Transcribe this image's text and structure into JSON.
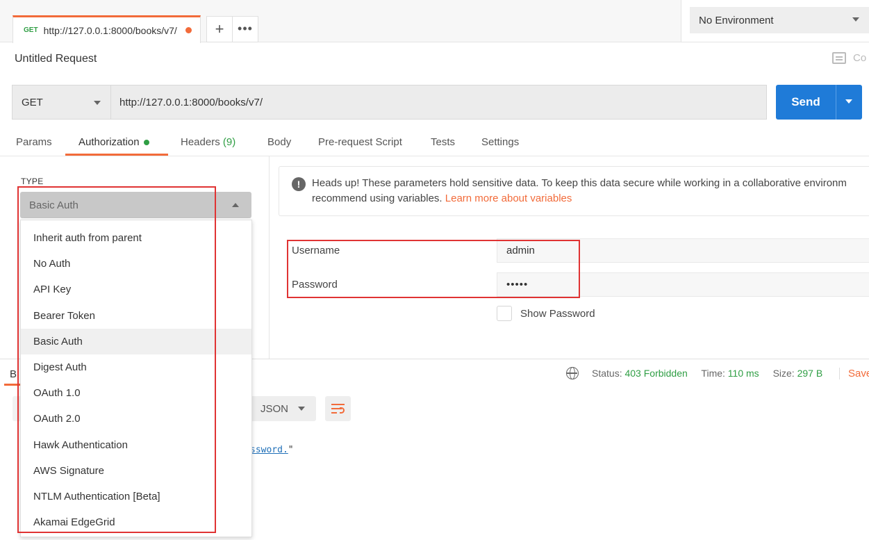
{
  "tab": {
    "method": "GET",
    "url": "http://127.0.0.1:8000/books/v7/",
    "new_tab": "+",
    "more": "•••"
  },
  "environment": {
    "selected": "No Environment"
  },
  "request": {
    "title": "Untitled Request",
    "comments_label": "Co",
    "method": "GET",
    "url": "http://127.0.0.1:8000/books/v7/",
    "send_label": "Send"
  },
  "request_tabs": {
    "params": "Params",
    "authorization": "Authorization",
    "headers": "Headers",
    "headers_count": "(9)",
    "body": "Body",
    "prerequest": "Pre-request Script",
    "tests": "Tests",
    "settings": "Settings"
  },
  "auth": {
    "type_label": "TYPE",
    "selected": "Basic Auth",
    "options": [
      "Inherit auth from parent",
      "No Auth",
      "API Key",
      "Bearer Token",
      "Basic Auth",
      "Digest Auth",
      "OAuth 1.0",
      "OAuth 2.0",
      "Hawk Authentication",
      "AWS Signature",
      "NTLM Authentication [Beta]",
      "Akamai EdgeGrid"
    ],
    "info_line1": "Heads up! These parameters hold sensitive data. To keep this data secure while working in a collaborative environm",
    "info_line2": "recommend using variables.",
    "info_link": "Learn more about variables",
    "username_label": "Username",
    "username_value": "admin",
    "password_label": "Password",
    "password_value": "•••••",
    "show_password_label": "Show Password"
  },
  "response": {
    "tab_label": "B",
    "status_label": "Status:",
    "status_value": "403 Forbidden",
    "time_label": "Time:",
    "time_value": "110 ms",
    "size_label": "Size:",
    "size_value": "297 B",
    "save_label": "Save",
    "format": "JSON",
    "body_link": "ssword.",
    "body_tail": "\""
  },
  "colors": {
    "accent": "#f26b3a",
    "primary": "#1f7bd8",
    "success": "#2f9e44",
    "highlight_box": "#e03333"
  }
}
